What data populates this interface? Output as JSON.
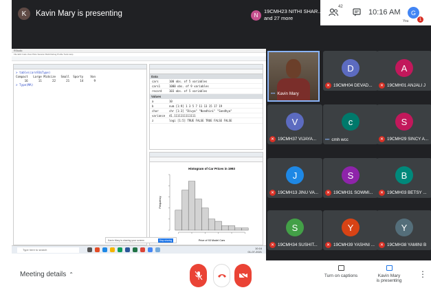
{
  "topbar": {
    "presenter_initial": "K",
    "presenter_text": "Kavin Mary is presenting",
    "participants_initial": "N",
    "participants_line1": "19CMH23 NITHI SHAR...",
    "participants_line2": "and 27 more",
    "people_count": "42",
    "time": "10:16 AM",
    "you_initial": "G",
    "you_label": "You",
    "notification_count": "1"
  },
  "screen": {
    "window_title": "RStudio",
    "menu": "File  Edit  Code  View  Plots  Session  Build  Debug  Profile  Tools  Help",
    "editor_lines": [
      {
        "text": "> table(cars93$Type)",
        "style": "blue"
      },
      {
        "text": "",
        "style": "blk"
      },
      {
        "text": "Compact   Large Midsize   Small  Sporty    Van",
        "style": "blk"
      },
      {
        "text": "     16      11      22      21      14      9",
        "style": "blk"
      },
      {
        "text": "> Type(MA)",
        "style": "blue"
      }
    ],
    "env_sections": {
      "data": "Data",
      "values": "Values"
    },
    "env_data": [
      {
        "name": "cars",
        "value": "100 obs. of 5 variables"
      },
      {
        "name": "cars1",
        "value": "1000 obs. of 9 variables"
      },
      {
        "name": "record",
        "value": "103 obs. of 5 variables"
      }
    ],
    "env_values": [
      {
        "name": "a",
        "value": "10"
      },
      {
        "name": "b",
        "value": "num [1:9] 1 3 5 7 11 13 15 17 19"
      },
      {
        "name": "char",
        "value": "chr [1:3] \"Divya\" \"Nandhini\" \"Sandhya\""
      },
      {
        "name": "variance",
        "value": "41.1111111111111"
      },
      {
        "name": "z",
        "value": "logi [1:5] TRUE FALSE TRUE FALSE FALSE"
      }
    ],
    "share_prompt": "Kavin Mary is sharing your screen",
    "stop_sharing": "Stop sharing",
    "hide": "Hide",
    "taskbar_search": "Type here to search",
    "taskbar_time": "10:16",
    "taskbar_date": "01-07-2021"
  },
  "chart_data": {
    "type": "bar",
    "title": "Histogram of Car Prices in 1993",
    "xlabel": "Price of 93 Model Cars",
    "ylabel": "Frequency",
    "categories": [
      "10",
      "15",
      "20",
      "25",
      "30",
      "35",
      "40",
      "45",
      "50",
      "55",
      "60"
    ],
    "values": [
      9,
      18,
      22,
      14,
      10,
      5,
      4,
      2,
      2,
      1,
      1
    ],
    "ylim": [
      0,
      25
    ],
    "xlim": [
      5,
      65
    ],
    "color": "#d3d3d3"
  },
  "kavin": {
    "name": "Kavin Mary"
  },
  "tiles": [
    {
      "initial": "D",
      "color": "#5c6bc0",
      "name": "19CMH04 DEVAD...",
      "muted": true
    },
    {
      "initial": "A",
      "color": "#c2185b",
      "name": "19CMH01 ANJALI J",
      "muted": true
    },
    {
      "initial": "V",
      "color": "#5c6bc0",
      "name": "19CMH37 VIJAYA...",
      "muted": true
    },
    {
      "initial": "c",
      "color": "#00796b",
      "name": "cmh wcc",
      "muted": false
    },
    {
      "initial": "S",
      "color": "#c2185b",
      "name": "19CMH29 SINCY A...",
      "muted": true
    },
    {
      "initial": "J",
      "color": "#1e88e5",
      "name": "19CMH13 JINU VA...",
      "muted": true
    },
    {
      "initial": "S",
      "color": "#8e24aa",
      "name": "19CMH31 SOWMI...",
      "muted": true
    },
    {
      "initial": "B",
      "color": "#00897b",
      "name": "19CMH03 BETSY ...",
      "muted": true
    },
    {
      "initial": "S",
      "color": "#43a047",
      "name": "19CMH34 SUSHIT...",
      "muted": true
    },
    {
      "initial": "Y",
      "color": "#d84315",
      "name": "19CMH39 YASHNI ...",
      "muted": true
    },
    {
      "initial": "Y",
      "color": "#546e7a",
      "name": "19CMH38 YAMINI B",
      "muted": true
    }
  ],
  "bottom": {
    "meeting_details": "Meeting details",
    "captions": "Turn on captions",
    "presenting_line1": "Kavin Mary",
    "presenting_line2": "is presenting"
  }
}
